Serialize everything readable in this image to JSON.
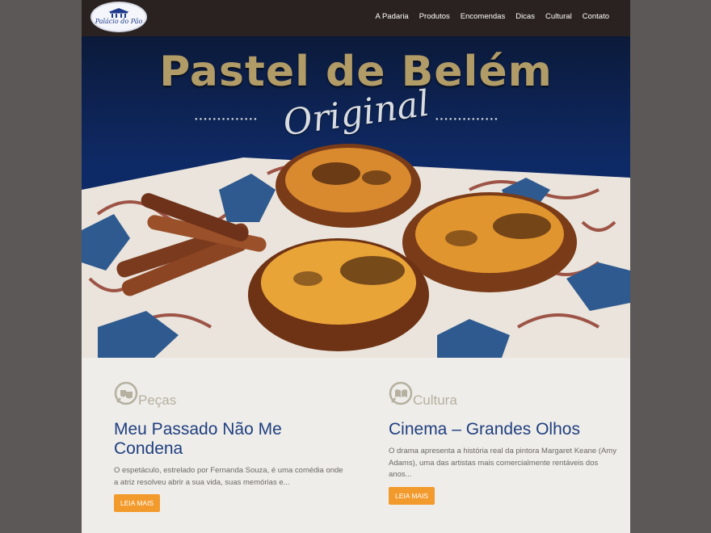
{
  "site": {
    "logo_text": "Palácio do Pão"
  },
  "nav": {
    "items": [
      "A Padaria",
      "Produtos",
      "Encomendas",
      "Dicas",
      "Cultural",
      "Contato"
    ]
  },
  "hero": {
    "title": "Pastel de Belém",
    "subtitle": "Original"
  },
  "posts": [
    {
      "category": "Peças",
      "category_icon": "theater-masks-icon",
      "title": "Meu Passado Não Me Condena",
      "excerpt": "O espetáculo, estrelado por Fernanda Souza, é uma comédia onde a atriz resolveu abrir a sua vida, suas memórias e...",
      "button": "LEIA MAIS"
    },
    {
      "category": "Cultura",
      "category_icon": "open-book-icon",
      "title": "Cinema – Grandes Olhos",
      "excerpt": "O drama apresenta a história real da pintora Margaret Keane (Amy Adams), uma das artistas mais comercialmente rentáveis dos anos...",
      "button": "LEIA MAIS"
    }
  ],
  "colors": {
    "header_bg": "#2a2220",
    "accent_button": "#f39a2d",
    "title_blue": "#1f3f7f",
    "category_gray": "#b5b09f",
    "page_bg": "#efedea",
    "outer_bg": "#5c5857"
  }
}
